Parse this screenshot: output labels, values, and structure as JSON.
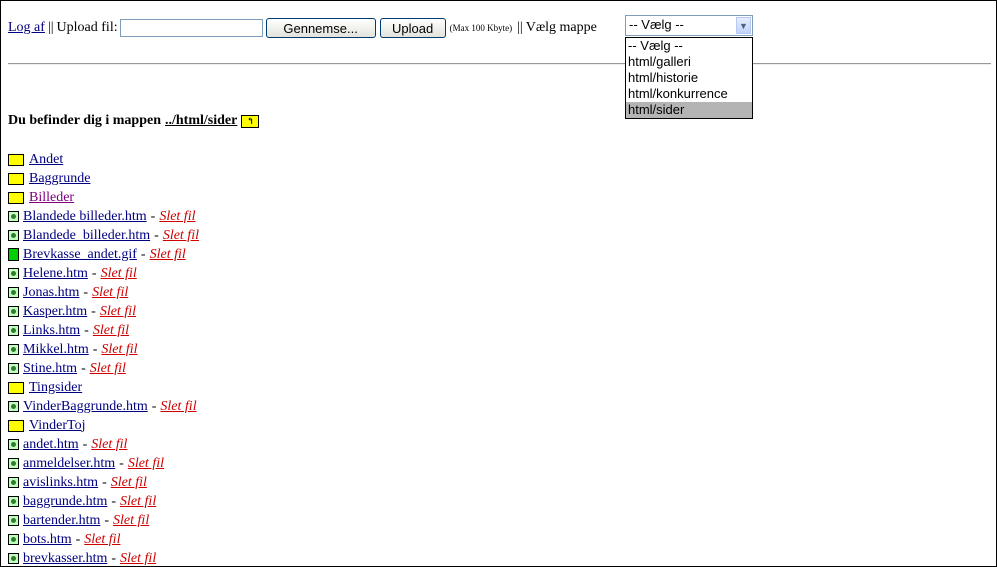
{
  "topbar": {
    "logout_label": "Log af",
    "sep": "||",
    "upload_label": "Upload fil:",
    "file_value": "",
    "browse_label": "Gennemse...",
    "upload_button_label": "Upload",
    "max_note": "(Max 100 Kbyte)",
    "choose_folder_label": "Vælg mappe"
  },
  "folder_select": {
    "selected": "-- Vælg --",
    "options": [
      {
        "label": "-- Vælg --",
        "selected": false
      },
      {
        "label": "html/galleri",
        "selected": false
      },
      {
        "label": "html/historie",
        "selected": false
      },
      {
        "label": "html/konkurrence",
        "selected": false
      },
      {
        "label": "html/sider",
        "selected": true
      }
    ]
  },
  "location": {
    "prefix": "Du befinder dig i mappen",
    "path": "../html/sider"
  },
  "delete_label": "Slet fil",
  "files": [
    {
      "name": "Andet",
      "type": "folder"
    },
    {
      "name": "Baggrunde",
      "type": "folder"
    },
    {
      "name": "Billeder",
      "type": "folder",
      "visited": true
    },
    {
      "name": "Blandede billeder.htm",
      "type": "htm"
    },
    {
      "name": "Blandede_billeder.htm",
      "type": "htm"
    },
    {
      "name": "Brevkasse_andet.gif",
      "type": "gif"
    },
    {
      "name": "Helene.htm",
      "type": "htm"
    },
    {
      "name": "Jonas.htm",
      "type": "htm"
    },
    {
      "name": "Kasper.htm",
      "type": "htm"
    },
    {
      "name": "Links.htm",
      "type": "htm"
    },
    {
      "name": "Mikkel.htm",
      "type": "htm"
    },
    {
      "name": "Stine.htm",
      "type": "htm"
    },
    {
      "name": "Tingsider",
      "type": "folder"
    },
    {
      "name": "VinderBaggrunde.htm",
      "type": "htm"
    },
    {
      "name": "VinderToj",
      "type": "folder"
    },
    {
      "name": "andet.htm",
      "type": "htm"
    },
    {
      "name": "anmeldelser.htm",
      "type": "htm"
    },
    {
      "name": "avislinks.htm",
      "type": "htm"
    },
    {
      "name": "baggrunde.htm",
      "type": "htm"
    },
    {
      "name": "bartender.htm",
      "type": "htm"
    },
    {
      "name": "bots.htm",
      "type": "htm"
    },
    {
      "name": "brevkasser.htm",
      "type": "htm"
    }
  ]
}
